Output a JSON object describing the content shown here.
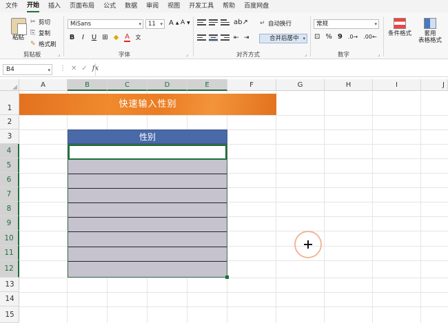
{
  "ribbon_tabs": [
    "文件",
    "开始",
    "插入",
    "页面布局",
    "公式",
    "数据",
    "审阅",
    "视图",
    "开发工具",
    "帮助",
    "百度网盘"
  ],
  "active_tab": "开始",
  "clipboard": {
    "paste": "粘贴",
    "cut": "剪切",
    "copy": "复制",
    "format_painter": "格式刷",
    "group": "剪贴板"
  },
  "font": {
    "name": "MiSans",
    "size": "11",
    "bold": "B",
    "italic": "I",
    "underline": "U",
    "group": "字体"
  },
  "alignment": {
    "wrap": "自动换行",
    "merge": "合并后居中",
    "group": "对齐方式"
  },
  "number": {
    "format": "常规",
    "percent": "%",
    "comma": "9",
    "group": "数字"
  },
  "styles": {
    "conditional": "条件格式",
    "table_line1": "套用",
    "table_line2": "表格格式"
  },
  "formula_bar": {
    "cell_ref": "B4",
    "fx": "fx",
    "content": ""
  },
  "columns": [
    "A",
    "B",
    "C",
    "D",
    "E",
    "F",
    "G",
    "H",
    "I",
    "J"
  ],
  "rows": [
    "1",
    "2",
    "3",
    "4",
    "5",
    "6",
    "7",
    "8",
    "9",
    "10",
    "11",
    "12",
    "13",
    "14",
    "15"
  ],
  "sheet": {
    "banner_title": "快速输入性别",
    "table_header": "性别",
    "data_rows": [
      "",
      "",
      "",
      "",
      "",
      "",
      "",
      "",
      ""
    ],
    "active_cell": "B4",
    "banner_color": "#ea7c24",
    "header_color": "#4a69a8",
    "row_fill_color": "#c6c2ce"
  }
}
